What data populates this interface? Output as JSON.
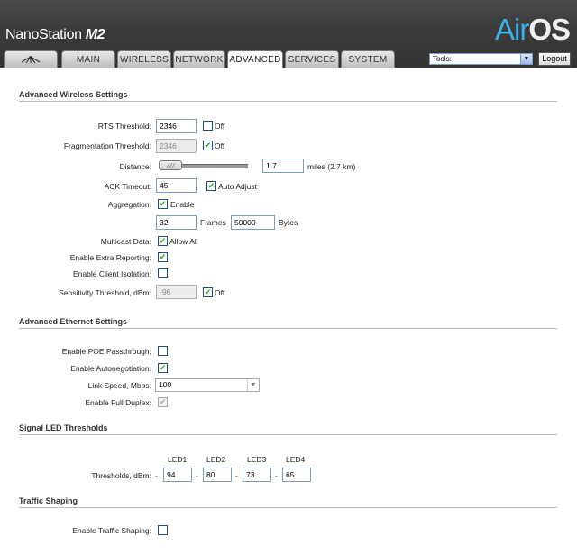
{
  "header": {
    "brand": "NanoStation",
    "model": "M2",
    "logo_air": "Air",
    "logo_os": "OS",
    "tabs": [
      {
        "id": "logo",
        "label": ""
      },
      {
        "id": "main",
        "label": "MAIN"
      },
      {
        "id": "wireless",
        "label": "WIRELESS"
      },
      {
        "id": "network",
        "label": "NETWORK"
      },
      {
        "id": "advanced",
        "label": "ADVANCED",
        "active": true
      },
      {
        "id": "services",
        "label": "SERVICES"
      },
      {
        "id": "system",
        "label": "SYSTEM"
      }
    ],
    "tools_label": "Tools:",
    "logout_label": "Logout"
  },
  "wireless": {
    "title": "Advanced Wireless Settings",
    "rts_label": "RTS Threshold:",
    "rts_value": "2346",
    "rts_off_label": "Off",
    "frag_label": "Fragmentation Threshold:",
    "frag_value": "2346",
    "frag_off_label": "Off",
    "distance_label": "Distance:",
    "distance_value": "1.7",
    "distance_unit": "miles (2.7 km)",
    "ack_label": "ACK Timeout:",
    "ack_value": "45",
    "ack_auto_label": "Auto Adjust",
    "aggr_label": "Aggregation:",
    "aggr_enable_label": "Enable",
    "frames_value": "32",
    "frames_label": "Frames",
    "bytes_value": "50000",
    "bytes_label": "Bytes",
    "multicast_label": "Multicast Data:",
    "multicast_allow_label": "Allow All",
    "extra_reporting_label": "Enable Extra Reporting:",
    "client_isolation_label": "Enable Client Isolation:",
    "sensitivity_label": "Sensitivity Threshold, dBm:",
    "sensitivity_value": "-96",
    "sensitivity_off_label": "Off"
  },
  "ethernet": {
    "title": "Advanced Ethernet Settings",
    "poe_label": "Enable POE Passthrough:",
    "autoneg_label": "Enable Autonegotiation:",
    "link_speed_label": "Link Speed, Mbps:",
    "link_speed_value": "100",
    "full_duplex_label": "Enable Full Duplex:"
  },
  "led": {
    "title": "Signal LED Thresholds",
    "headers": [
      "LED1",
      "LED2",
      "LED3",
      "LED4"
    ],
    "thresholds_label": "Thresholds, dBm:",
    "values": [
      "94",
      "80",
      "73",
      "65"
    ],
    "sep": "-"
  },
  "traffic": {
    "title": "Traffic Shaping",
    "enable_label": "Enable Traffic Shaping:"
  },
  "colors": {
    "header_bg": "#3c3c3c",
    "logo_accent": "#3ab0e8",
    "check_green": "#21a121"
  }
}
